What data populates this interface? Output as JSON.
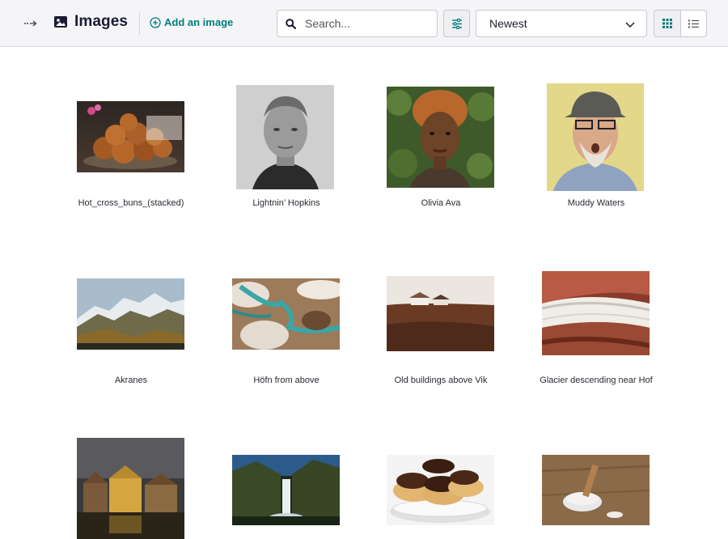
{
  "header": {
    "title": "Images",
    "add_label": "Add an image",
    "search_placeholder": "Search...",
    "sort_value": "Newest",
    "icons": {
      "sidebar": "sidebar-toggle-icon",
      "title": "image-icon",
      "add": "plus-circle-icon",
      "search": "search-icon",
      "filter": "sliders-icon",
      "sort": "chevron-down-icon",
      "grid": "grid-icon",
      "list": "list-icon"
    },
    "accent": "#007d7e"
  },
  "images": [
    {
      "title": "Hot_cross_buns_(stacked)"
    },
    {
      "title": "Lightnin’ Hopkins"
    },
    {
      "title": "Olivia Ava"
    },
    {
      "title": "Muddy Waters"
    },
    {
      "title": "Akranes"
    },
    {
      "title": "Höfn from above"
    },
    {
      "title": "Old buildings above Vik"
    },
    {
      "title": "Glacier descending near Hof"
    },
    {
      "title": ""
    },
    {
      "title": ""
    },
    {
      "title": ""
    },
    {
      "title": ""
    }
  ]
}
